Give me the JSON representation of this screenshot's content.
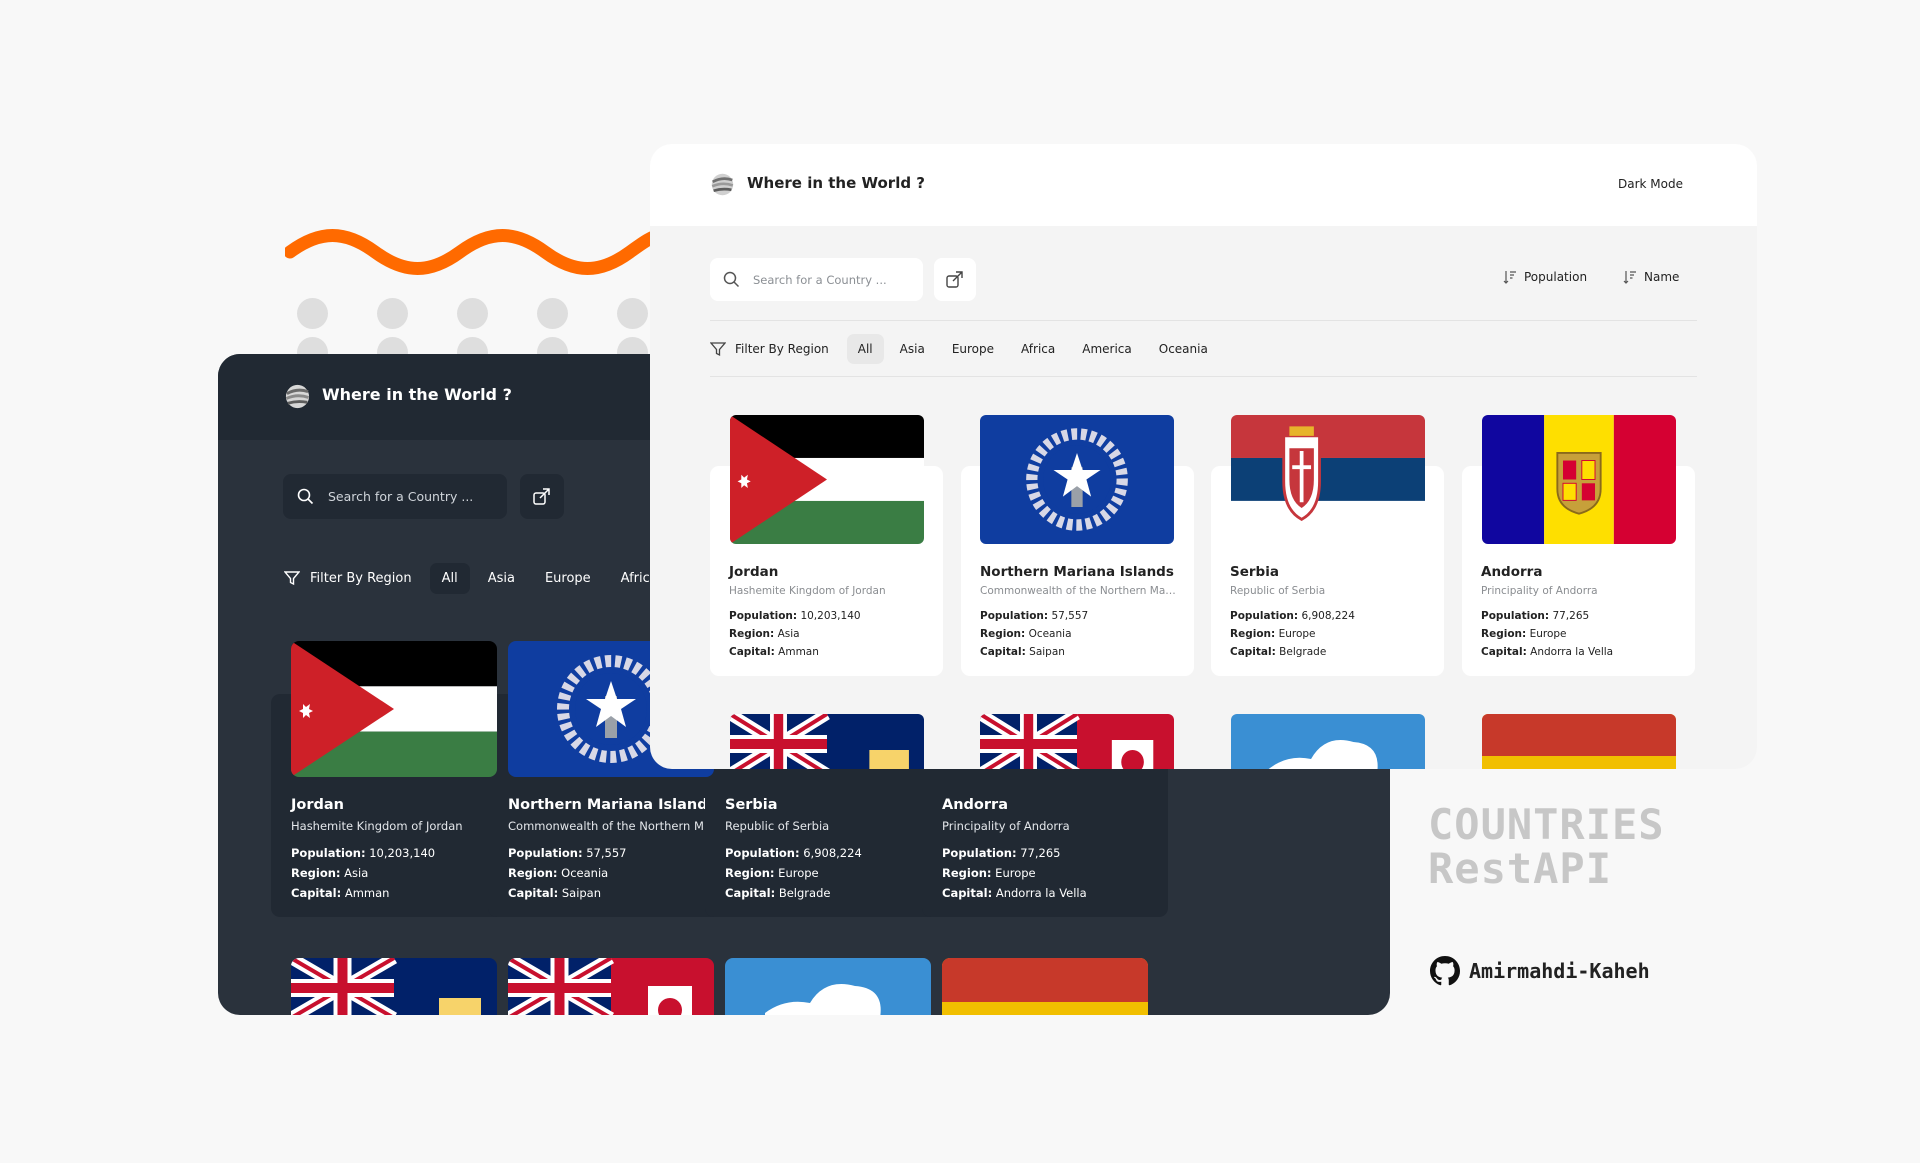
{
  "app": {
    "title": "Where in the World ?",
    "dark_mode_label": "Dark Mode"
  },
  "search": {
    "placeholder": "Search for a Country ..."
  },
  "sort": {
    "population_label": "Population",
    "name_label": "Name"
  },
  "filter": {
    "label": "Filter By Region",
    "regions_light": [
      "All",
      "Asia",
      "Europe",
      "Africa",
      "America",
      "Oceania"
    ],
    "regions_dark": [
      "All",
      "Asia",
      "Europe",
      "Africa"
    ],
    "active": "All"
  },
  "labels": {
    "population": "Population:",
    "region": "Region:",
    "capital": "Capital:"
  },
  "countries": [
    {
      "name": "Jordan",
      "official": "Hashemite Kingdom of Jordan",
      "population": "10,203,140",
      "region": "Asia",
      "capital": "Amman"
    },
    {
      "name": "Northern Mariana Islands",
      "official": "Commonwealth of the Northern Mariana Islands",
      "population": "57,557",
      "region": "Oceania",
      "capital": "Saipan"
    },
    {
      "name": "Serbia",
      "official": "Republic of Serbia",
      "population": "6,908,224",
      "region": "Europe",
      "capital": "Belgrade"
    },
    {
      "name": "Andorra",
      "official": "Principality of Andorra",
      "population": "77,265",
      "region": "Europe",
      "capital": "Andorra la Vella"
    }
  ],
  "brand": {
    "line1": "COUNTRIES",
    "line2": "RestAPI"
  },
  "github": {
    "user": "Amirmahdi-Kaheh"
  },
  "colors": {
    "accent_wave": "#ff6a00",
    "dark_bg": "#2a323c",
    "dark_header": "#212933",
    "light_bg": "#f4f4f4"
  },
  "icons": [
    "search-icon",
    "share-icon",
    "filter-icon",
    "sort-icon",
    "globe-logo-icon",
    "github-icon"
  ]
}
